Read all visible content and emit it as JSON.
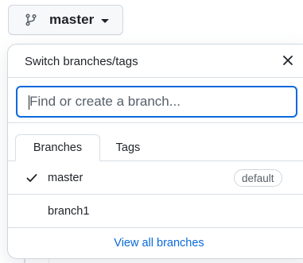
{
  "branch_button": {
    "label": "master",
    "icon": "git-branch-icon"
  },
  "popover": {
    "title": "Switch branches/tags",
    "close_icon": "close-icon",
    "filter": {
      "placeholder": "Find or create a branch...",
      "value": ""
    },
    "tabs": [
      {
        "label": "Branches",
        "active": true
      },
      {
        "label": "Tags",
        "active": false
      }
    ],
    "branches": [
      {
        "name": "master",
        "selected": true,
        "badge": "default"
      },
      {
        "name": "branch1",
        "selected": false,
        "badge": ""
      }
    ],
    "footer_link": "View all branches"
  },
  "colors": {
    "accent": "#0969da",
    "border": "#d0d7de",
    "text": "#1f2328",
    "muted": "#57606a"
  }
}
